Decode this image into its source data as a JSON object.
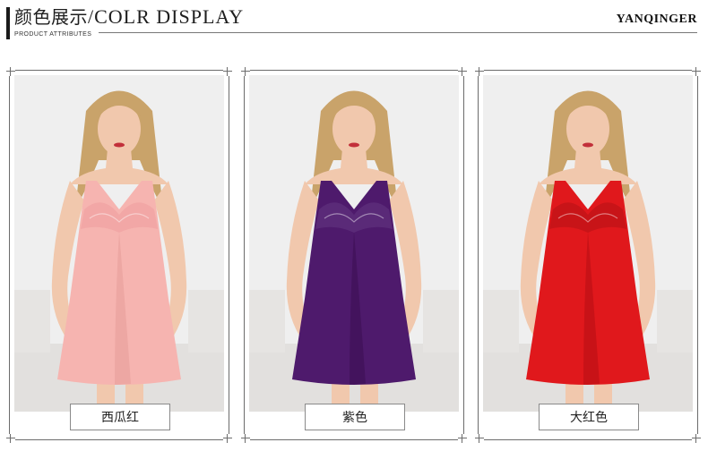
{
  "header": {
    "title_cn": "颜色展示",
    "title_en": "/COLR DISPLAY",
    "subtitle": "PRODUCT ATTRIBUTES",
    "brand": "YANQINGER"
  },
  "products": [
    {
      "label": "西瓜红",
      "dress_color": "#f6b4b0",
      "dress_shade": "#e59d99",
      "lace_color": "#f2a7a6"
    },
    {
      "label": "紫色",
      "dress_color": "#4e1a6c",
      "dress_shade": "#3a0f52",
      "lace_color": "#5a2a78"
    },
    {
      "label": "大红色",
      "dress_color": "#e0181c",
      "dress_shade": "#b50f14",
      "lace_color": "#c81418"
    }
  ],
  "colors": {
    "frame": "#6c6c6c",
    "backdrop": "#efefef",
    "skin": "#f1c8ad",
    "hair": "#c9a36a"
  }
}
